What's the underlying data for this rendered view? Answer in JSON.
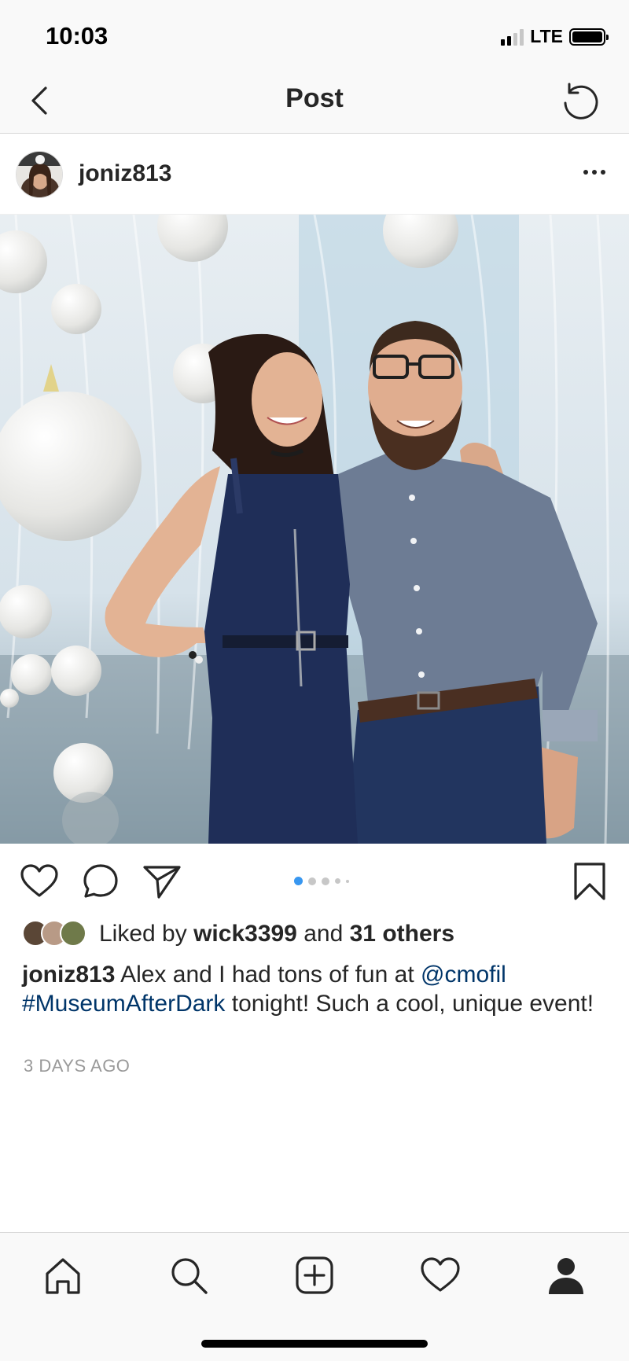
{
  "status_bar": {
    "time": "10:03",
    "network": "LTE"
  },
  "nav": {
    "title": "Post",
    "back_icon": "chevron-left-icon",
    "refresh_icon": "refresh-icon"
  },
  "post": {
    "username": "joniz813",
    "more_icon": "more-horizontal-icon",
    "photo_description_icon": "photo",
    "carousel": {
      "total": 5,
      "active_index": 0
    }
  },
  "actions": {
    "like_icon": "heart-icon",
    "comment_icon": "comment-icon",
    "share_icon": "send-icon",
    "save_icon": "bookmark-icon"
  },
  "likes": {
    "prefix": "Liked by",
    "user": "wick3399",
    "middle": "and",
    "others": "31 others"
  },
  "caption": {
    "username": "joniz813",
    "text_1": "Alex and I had tons of fun at",
    "mention": "@cmofil",
    "hashtag": "#MuseumAfterDark",
    "text_2": "tonight! Such a cool, unique event!"
  },
  "timestamp": "3 DAYS AGO",
  "tab_bar": {
    "items": [
      "home-icon",
      "search-icon",
      "new-post-icon",
      "activity-heart-icon",
      "profile-icon"
    ]
  },
  "colors": {
    "accent": "#3897f0",
    "link": "#003569",
    "text": "#262626",
    "muted": "#999999"
  }
}
